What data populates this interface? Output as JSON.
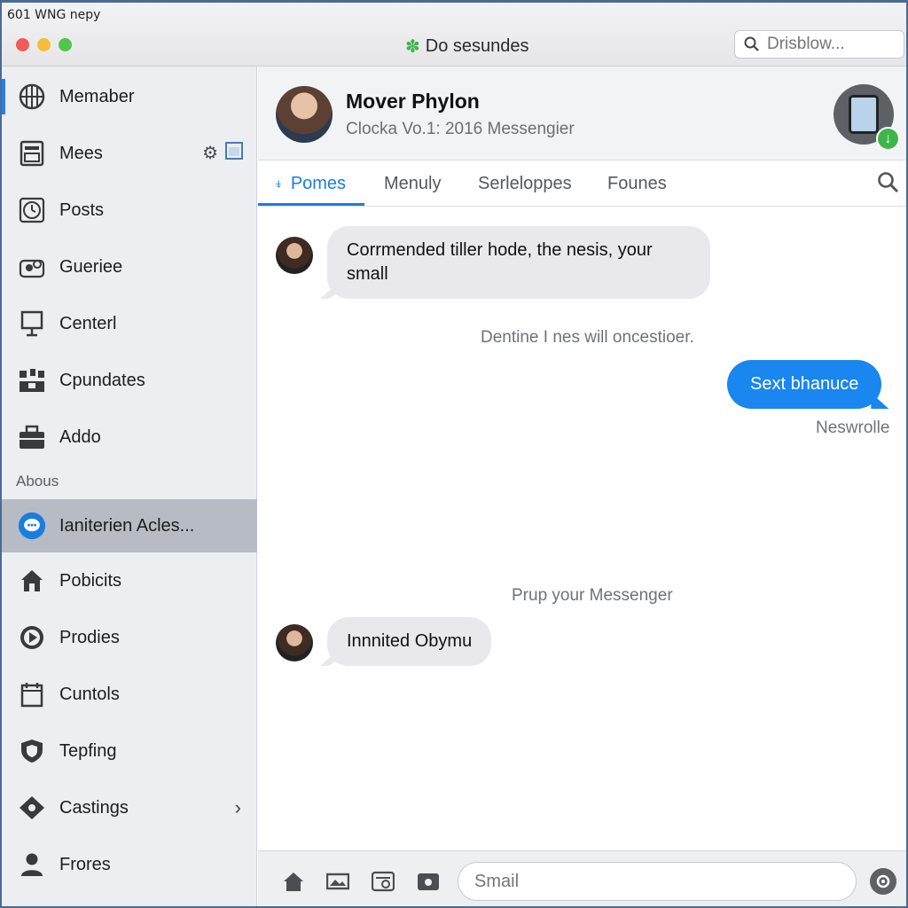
{
  "os_bar": {
    "text": "601 WNG nepy"
  },
  "window": {
    "title": "Do sesundes",
    "search_placeholder": "Drisblow..."
  },
  "sidebar": {
    "items": [
      {
        "label": "Memaber",
        "icon": "grid-globe-icon"
      },
      {
        "label": "Mees",
        "icon": "inbox-icon"
      },
      {
        "label": "Posts",
        "icon": "clock-icon"
      },
      {
        "label": "Gueriee",
        "icon": "people-icon"
      },
      {
        "label": "Centerl",
        "icon": "monitor-icon"
      },
      {
        "label": "Cpundates",
        "icon": "apps-icon"
      },
      {
        "label": "Addo",
        "icon": "briefcase-icon"
      }
    ],
    "section_header": "Abous",
    "section_items": [
      {
        "label": "Ianiterien Acles...",
        "icon": "messenger-icon",
        "selected": true
      },
      {
        "label": "Pobicits",
        "icon": "home-icon"
      },
      {
        "label": "Prodies",
        "icon": "play-icon"
      },
      {
        "label": "Cuntols",
        "icon": "calendar-icon"
      },
      {
        "label": "Tepfing",
        "icon": "shield-icon"
      },
      {
        "label": "Castings",
        "icon": "diamond-icon"
      },
      {
        "label": "Frores",
        "icon": "person-icon"
      }
    ]
  },
  "chat": {
    "contact_name": "Mover Phylon",
    "contact_subtitle": "Clocka Vo.1: 2016 Messengier",
    "tabs": [
      "Pomes",
      "Menuly",
      "Serleloppes",
      "Founes"
    ],
    "active_tab": 0,
    "messages": {
      "incoming_1": "Corrmended tiller hode, the nesis, your small",
      "system_1": "Dentine I nes will oncestioer.",
      "outgoing_1": "Sext bhanuce",
      "outgoing_1_status": "Neswrolle",
      "system_2": "Prup your Messenger",
      "incoming_2": "Innnited Obymu"
    },
    "compose_placeholder": "Smail"
  },
  "colors": {
    "accent": "#1a86ef",
    "selected_row": "#b7bcc4",
    "online_badge": "#3db54a"
  }
}
